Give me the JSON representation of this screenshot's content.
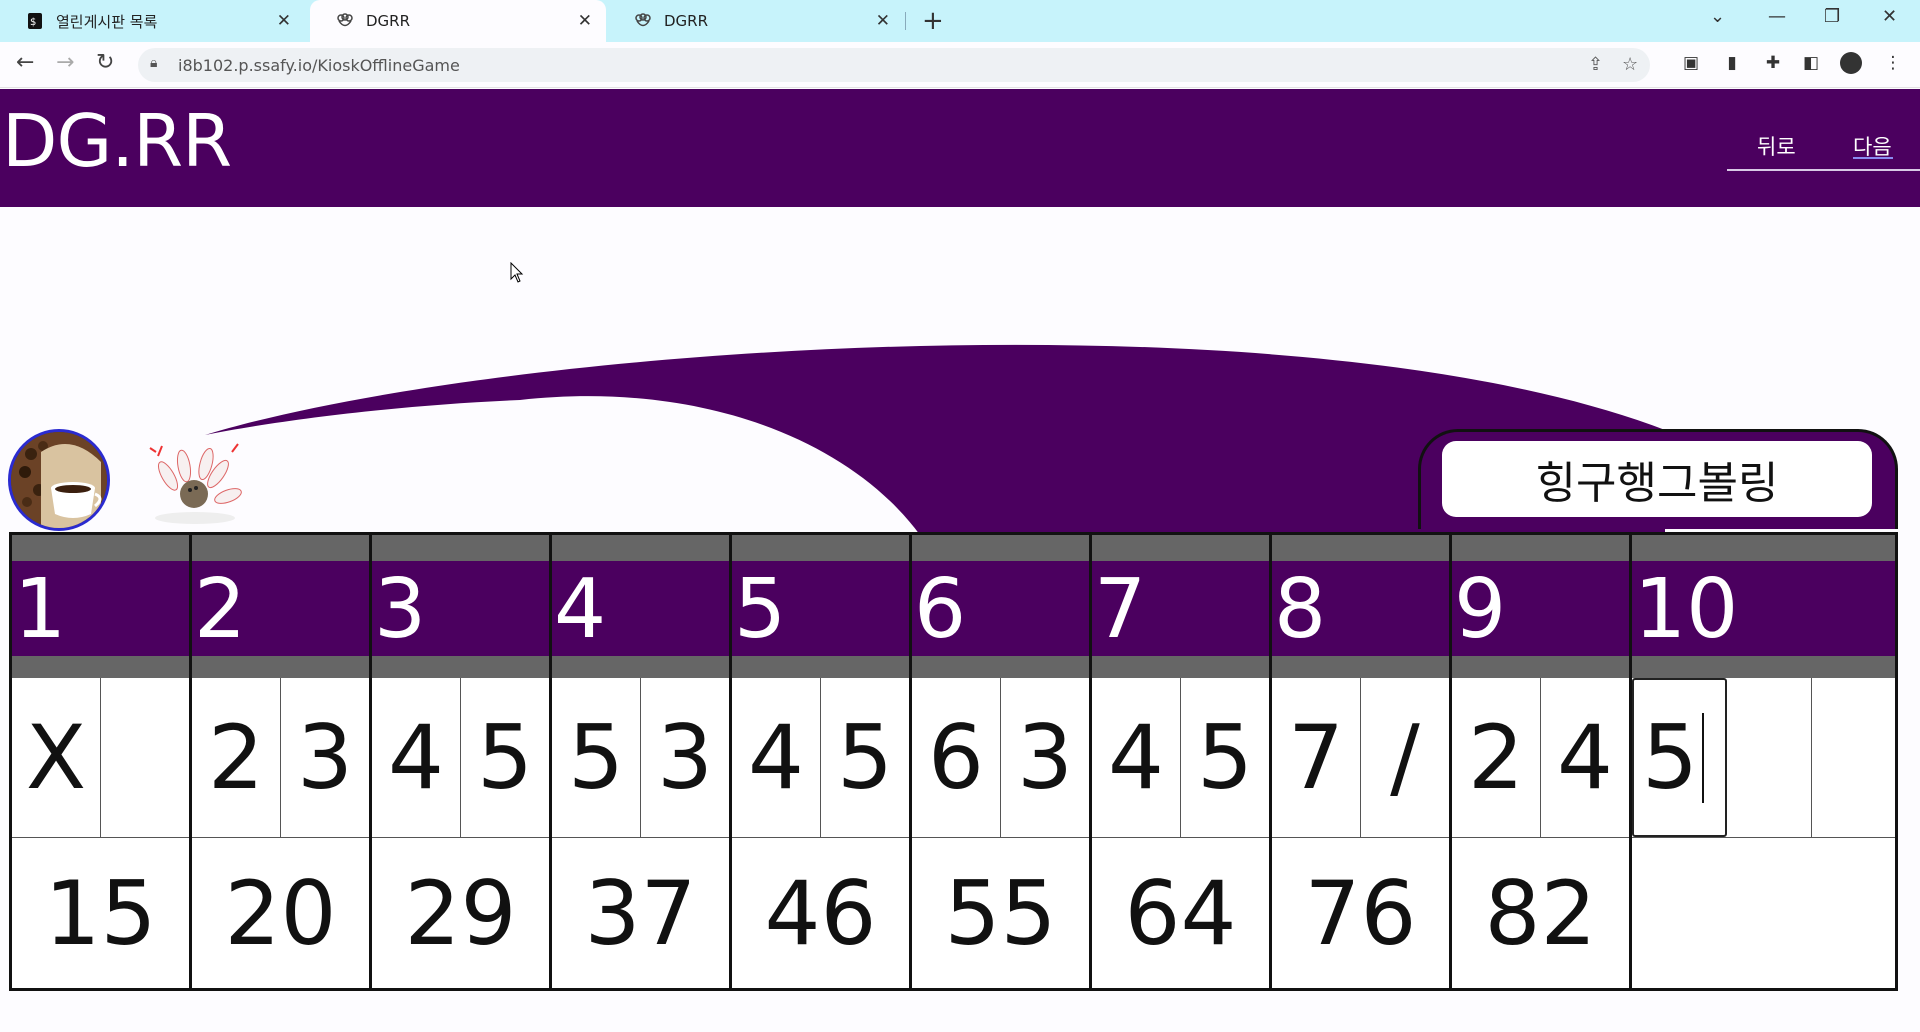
{
  "browser": {
    "tabs": [
      {
        "title": "열린게시판 목록",
        "icon": "bookmark-icon",
        "active": false
      },
      {
        "title": "DGRR",
        "icon": "pins-favicon",
        "active": true
      },
      {
        "title": "DGRR",
        "icon": "pins-favicon",
        "active": false
      }
    ],
    "url": "i8b102.p.ssafy.io/KioskOfflineGame"
  },
  "header": {
    "logo": "DG.RR",
    "nav": {
      "back": "뒤로",
      "next": "다음"
    }
  },
  "player": {
    "name": "힝구행그볼링"
  },
  "scoreboard": {
    "frames": [
      {
        "number": "1",
        "rolls": [
          "X",
          ""
        ],
        "total": "15"
      },
      {
        "number": "2",
        "rolls": [
          "2",
          "3"
        ],
        "total": "20"
      },
      {
        "number": "3",
        "rolls": [
          "4",
          "5"
        ],
        "total": "29"
      },
      {
        "number": "4",
        "rolls": [
          "5",
          "3"
        ],
        "total": "37"
      },
      {
        "number": "5",
        "rolls": [
          "4",
          "5"
        ],
        "total": "46"
      },
      {
        "number": "6",
        "rolls": [
          "6",
          "3"
        ],
        "total": "55"
      },
      {
        "number": "7",
        "rolls": [
          "4",
          "5"
        ],
        "total": "64"
      },
      {
        "number": "8",
        "rolls": [
          "7",
          "/"
        ],
        "total": "76"
      },
      {
        "number": "9",
        "rolls": [
          "2",
          "4"
        ],
        "total": "82"
      },
      {
        "number": "10",
        "rolls": [
          "5",
          "",
          ""
        ],
        "total": ""
      }
    ]
  },
  "colors": {
    "brand": "#4b005f",
    "header_gray": "#666666",
    "tab_bar": "#c7f3fb"
  }
}
